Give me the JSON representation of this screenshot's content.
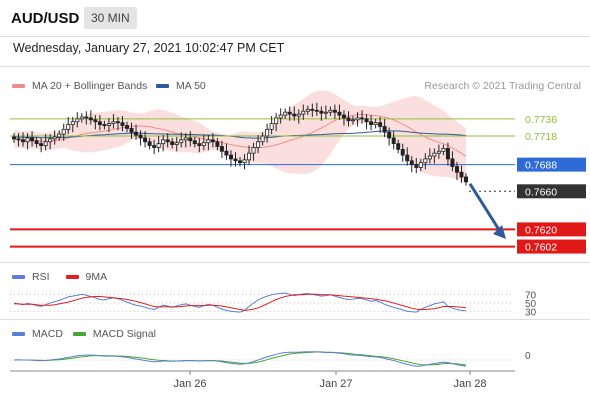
{
  "header": {
    "symbol": "AUD/USD",
    "timeframe": "30 MIN"
  },
  "dateline": "Wednesday, January 27, 2021 10:02:47 PM CET",
  "legend": {
    "bollinger": {
      "label": "MA 20 + Bollinger Bands",
      "color": "#f28b8b"
    },
    "ma50": {
      "label": "MA 50",
      "color": "#2f5a9e"
    },
    "copyright": "Research © 2021 Trading Central"
  },
  "rsi_legend": {
    "rsi": {
      "label": "RSI",
      "color": "#5b7fd4"
    },
    "ma": {
      "label": "9MA",
      "color": "#e02020"
    }
  },
  "macd_legend": {
    "macd": {
      "label": "MACD",
      "color": "#5b7fd4"
    },
    "signal": {
      "label": "MACD Signal",
      "color": "#48a830"
    }
  },
  "colors": {
    "green_level": "#8fbf3a",
    "blue_level": "#2e6bd6",
    "red_level": "#e01818",
    "current": "#333333",
    "candle": "#222222",
    "arrow": "#2f5a9e"
  },
  "chart_data": [
    {
      "type": "candlestick",
      "title": "AUD/USD",
      "ylim": [
        0.759,
        0.776
      ],
      "x_tick_labels": [
        "Jan 26",
        "Jan 27",
        "Jan 28"
      ],
      "overlays": [
        "MA 20 + Bollinger Bands",
        "MA 50"
      ],
      "close": [
        0.7715,
        0.7714,
        0.7712,
        0.7716,
        0.7713,
        0.771,
        0.7708,
        0.7712,
        0.7715,
        0.7717,
        0.772,
        0.7725,
        0.773,
        0.7733,
        0.7736,
        0.7738,
        0.7737,
        0.7735,
        0.7733,
        0.773,
        0.7729,
        0.7731,
        0.7733,
        0.7732,
        0.7729,
        0.7726,
        0.7722,
        0.7719,
        0.7716,
        0.7712,
        0.7708,
        0.7706,
        0.771,
        0.7714,
        0.7712,
        0.7709,
        0.7711,
        0.7714,
        0.7716,
        0.7713,
        0.771,
        0.7708,
        0.7711,
        0.7714,
        0.7712,
        0.7707,
        0.7702,
        0.7698,
        0.7694,
        0.7692,
        0.769,
        0.7693,
        0.77,
        0.7706,
        0.7712,
        0.7718,
        0.7725,
        0.7731,
        0.7737,
        0.774,
        0.7743,
        0.7741,
        0.7739,
        0.7741,
        0.7744,
        0.7746,
        0.7745,
        0.7744,
        0.7742,
        0.7743,
        0.7745,
        0.7743,
        0.774,
        0.7737,
        0.7734,
        0.7735,
        0.7737,
        0.7736,
        0.7733,
        0.773,
        0.7732,
        0.7728,
        0.7722,
        0.7716,
        0.771,
        0.7704,
        0.7698,
        0.7692,
        0.7688,
        0.7685,
        0.769,
        0.7694,
        0.7697,
        0.77,
        0.7702,
        0.7705,
        0.7694,
        0.7686,
        0.768,
        0.7675,
        0.767
      ],
      "levels": [
        {
          "label": "0.7736",
          "value": 0.7736,
          "kind": "green"
        },
        {
          "label": "0.7718",
          "value": 0.7718,
          "kind": "green"
        },
        {
          "label": "0.7688",
          "value": 0.7688,
          "kind": "blue"
        },
        {
          "label": "0.7660",
          "value": 0.766,
          "kind": "current"
        },
        {
          "label": "0.7620",
          "value": 0.762,
          "kind": "red"
        },
        {
          "label": "0.7602",
          "value": 0.7602,
          "kind": "red"
        }
      ]
    },
    {
      "type": "line",
      "title": "RSI",
      "ylim": [
        20,
        80
      ],
      "y_tick_labels": [
        "70",
        "50",
        "30"
      ],
      "series": [
        {
          "name": "RSI",
          "values": [
            50,
            48,
            46,
            49,
            47,
            44,
            42,
            46,
            50,
            53,
            56,
            60,
            64,
            66,
            68,
            70,
            68,
            65,
            62,
            58,
            57,
            60,
            62,
            60,
            56,
            52,
            48,
            45,
            43,
            40,
            37,
            35,
            40,
            45,
            43,
            40,
            43,
            46,
            48,
            45,
            42,
            40,
            44,
            47,
            45,
            40,
            36,
            33,
            31,
            30,
            29,
            33,
            42,
            50,
            57,
            62,
            66,
            69,
            71,
            72,
            73,
            70,
            67,
            69,
            71,
            72,
            70,
            68,
            66,
            67,
            69,
            66,
            63,
            60,
            58,
            59,
            61,
            60,
            57,
            54,
            56,
            52,
            47,
            43,
            40,
            37,
            34,
            31,
            30,
            29,
            35,
            40,
            44,
            48,
            50,
            53,
            42,
            38,
            35,
            33,
            32
          ]
        },
        {
          "name": "9MA",
          "values": [
            48,
            48,
            47,
            47,
            47,
            46,
            45,
            45,
            45,
            46,
            48,
            50,
            52,
            55,
            58,
            61,
            63,
            64,
            65,
            65,
            64,
            63,
            62,
            61,
            60,
            58,
            56,
            54,
            51,
            48,
            45,
            42,
            41,
            41,
            41,
            41,
            41,
            42,
            43,
            44,
            44,
            44,
            44,
            45,
            45,
            44,
            43,
            41,
            39,
            37,
            35,
            33,
            34,
            36,
            39,
            43,
            48,
            53,
            58,
            62,
            65,
            67,
            69,
            69,
            69,
            70,
            70,
            70,
            69,
            69,
            69,
            68,
            67,
            66,
            65,
            64,
            63,
            62,
            61,
            60,
            59,
            57,
            55,
            53,
            50,
            47,
            44,
            41,
            38,
            36,
            35,
            35,
            36,
            37,
            39,
            42,
            42,
            42,
            41,
            40,
            39
          ]
        }
      ]
    },
    {
      "type": "line",
      "title": "MACD",
      "y_tick_labels": [
        "0"
      ],
      "series": [
        {
          "name": "MACD",
          "values": [
            0.0,
            0.1,
            0.0,
            0.0,
            -0.1,
            -0.2,
            -0.3,
            -0.2,
            0.0,
            0.2,
            0.4,
            0.7,
            1.0,
            1.3,
            1.6,
            1.8,
            1.9,
            1.9,
            1.8,
            1.6,
            1.5,
            1.5,
            1.5,
            1.4,
            1.2,
            1.0,
            0.7,
            0.4,
            0.1,
            -0.2,
            -0.5,
            -0.7,
            -0.6,
            -0.4,
            -0.4,
            -0.5,
            -0.4,
            -0.3,
            -0.2,
            -0.2,
            -0.3,
            -0.4,
            -0.3,
            -0.2,
            -0.2,
            -0.4,
            -0.7,
            -1.0,
            -1.3,
            -1.5,
            -1.6,
            -1.5,
            -1.1,
            -0.6,
            0.0,
            0.6,
            1.2,
            1.7,
            2.2,
            2.6,
            2.9,
            3.0,
            3.0,
            3.0,
            3.1,
            3.2,
            3.2,
            3.1,
            3.0,
            2.9,
            2.9,
            2.8,
            2.6,
            2.4,
            2.1,
            1.9,
            1.8,
            1.7,
            1.5,
            1.3,
            1.2,
            1.0,
            0.6,
            0.2,
            -0.2,
            -0.7,
            -1.2,
            -1.7,
            -2.1,
            -2.4,
            -2.3,
            -2.0,
            -1.7,
            -1.4,
            -1.1,
            -0.8,
            -1.0,
            -1.4,
            -1.8,
            -2.1,
            -2.4
          ]
        },
        {
          "name": "MACD Signal",
          "values": [
            0.0,
            0.0,
            0.0,
            0.0,
            0.0,
            -0.1,
            -0.1,
            -0.2,
            -0.1,
            0.0,
            0.1,
            0.3,
            0.5,
            0.7,
            1.0,
            1.2,
            1.4,
            1.6,
            1.7,
            1.7,
            1.7,
            1.6,
            1.6,
            1.5,
            1.5,
            1.4,
            1.2,
            1.0,
            0.8,
            0.6,
            0.3,
            0.1,
            -0.1,
            -0.2,
            -0.3,
            -0.4,
            -0.4,
            -0.4,
            -0.3,
            -0.3,
            -0.3,
            -0.3,
            -0.3,
            -0.3,
            -0.3,
            -0.3,
            -0.4,
            -0.6,
            -0.8,
            -1.0,
            -1.2,
            -1.3,
            -1.3,
            -1.1,
            -0.8,
            -0.4,
            0.1,
            0.6,
            1.1,
            1.5,
            1.9,
            2.3,
            2.5,
            2.7,
            2.8,
            2.9,
            3.0,
            3.1,
            3.1,
            3.0,
            3.0,
            2.9,
            2.8,
            2.7,
            2.5,
            2.3,
            2.1,
            2.0,
            1.8,
            1.6,
            1.4,
            1.3,
            1.1,
            0.8,
            0.5,
            0.1,
            -0.3,
            -0.7,
            -1.1,
            -1.5,
            -1.8,
            -1.9,
            -1.9,
            -1.8,
            -1.6,
            -1.4,
            -1.3,
            -1.4,
            -1.5,
            -1.7,
            -1.9
          ]
        }
      ]
    }
  ]
}
